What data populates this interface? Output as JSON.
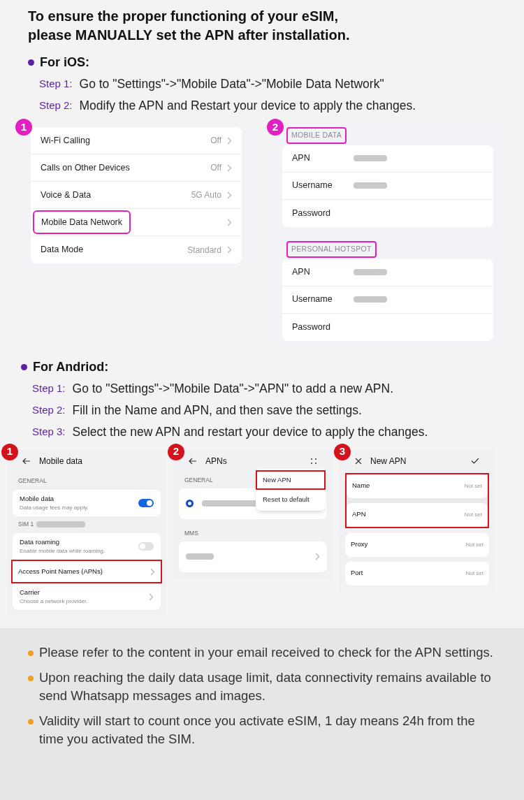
{
  "heading_lines": [
    "To ensure the proper functioning of your eSIM,",
    "please MANUALLY set the APN after installation."
  ],
  "sections": [
    {
      "kind": "ios",
      "title": "For iOS:",
      "steps": [
        {
          "label": "Step 1:",
          "text": "Go to  \"Settings\"->\"Mobile Data\"->\"Mobile Data Network\""
        },
        {
          "label": "Step 2:",
          "text": "Modify the APN and Restart your device to apply the changes."
        }
      ],
      "screens": [
        {
          "kind": "ios_list",
          "badge": "1",
          "rows": [
            {
              "label": "Wi-Fi Calling",
              "value": "Off",
              "highlighted": false
            },
            {
              "label": "Calls on Other Devices",
              "value": "Off",
              "highlighted": false
            },
            {
              "label": "Voice & Data",
              "value": "5G Auto",
              "highlighted": false
            },
            {
              "label": "Mobile Data Network",
              "highlighted": true
            },
            {
              "label": "Data Mode",
              "value": "Standard",
              "highlighted": false
            }
          ]
        },
        {
          "kind": "ios_groups",
          "badge": "2",
          "groups": [
            {
              "header": "MOBILE DATA",
              "highlighted": true,
              "rows": [
                {
                  "label": "APN",
                  "redacted": true
                },
                {
                  "label": "Username",
                  "redacted": true
                },
                {
                  "label": "Password",
                  "redacted": false
                }
              ]
            },
            {
              "header": "PERSONAL HOTSPOT",
              "highlighted": true,
              "rows": [
                {
                  "label": "APN",
                  "redacted": true
                },
                {
                  "label": "Username",
                  "redacted": true
                },
                {
                  "label": "Password",
                  "redacted": false
                }
              ]
            }
          ]
        }
      ]
    },
    {
      "kind": "android",
      "title": "For Andriod:",
      "steps": [
        {
          "label": "Step 1:",
          "text": "Go to \"Settings\"->\"Mobile Data\"->\"APN\" to add a new APN."
        },
        {
          "label": "Step 2:",
          "text": "Fill in the Name and APN, and then save the settings."
        },
        {
          "label": "Step 3:",
          "text": "Select the new APN and restart your device to apply the changes."
        }
      ],
      "screens": [
        {
          "kind": "android_settings",
          "badge": "1",
          "title": "Mobile data",
          "groups": [
            {
              "header": "GENERAL",
              "rows": [
                {
                  "kind": "toggle",
                  "label": "Mobile data",
                  "subtitle": "Data usage fees may apply.",
                  "on": true,
                  "highlighted": false
                }
              ]
            },
            {
              "header": "SIM 1",
              "header_redacted": true,
              "rows": [
                {
                  "kind": "toggle",
                  "label": "Data roaming",
                  "subtitle": "Enable mobile data while roaming.",
                  "on": false,
                  "highlighted": false
                },
                {
                  "kind": "link",
                  "label": "Access Point Names (APNs)",
                  "highlighted": true
                },
                {
                  "kind": "link",
                  "label": "Carrier",
                  "subtitle": "Choose a network provider.",
                  "highlighted": false
                }
              ]
            }
          ]
        },
        {
          "kind": "android_apns",
          "badge": "2",
          "title": "APNs",
          "menu": [
            {
              "label": "New APN",
              "highlighted": true
            },
            {
              "label": "Reset to default",
              "highlighted": false
            }
          ],
          "groups": [
            {
              "header": "GENERAL",
              "kind": "radio",
              "selected": true
            },
            {
              "header": "MMS",
              "kind": "link"
            }
          ]
        },
        {
          "kind": "android_form",
          "badge": "3",
          "title": "New APN",
          "fields": [
            {
              "label": "Name",
              "value": "Not set",
              "highlighted": true
            },
            {
              "label": "APN",
              "value": "Not set",
              "highlighted": true
            },
            {
              "label": "Proxy",
              "value": "Not set",
              "highlighted": false
            },
            {
              "label": "Port",
              "value": "Not set",
              "highlighted": false
            }
          ]
        }
      ]
    }
  ],
  "notes": [
    "Please refer to the content in your email received to check for the APN settings.",
    "Upon reaching the daily data usage limit, data connectivity remains available to send Whatsapp messages and images.",
    "Validity will start to count once you activate eSIM, 1 day means 24h from the time you activated the SIM."
  ]
}
